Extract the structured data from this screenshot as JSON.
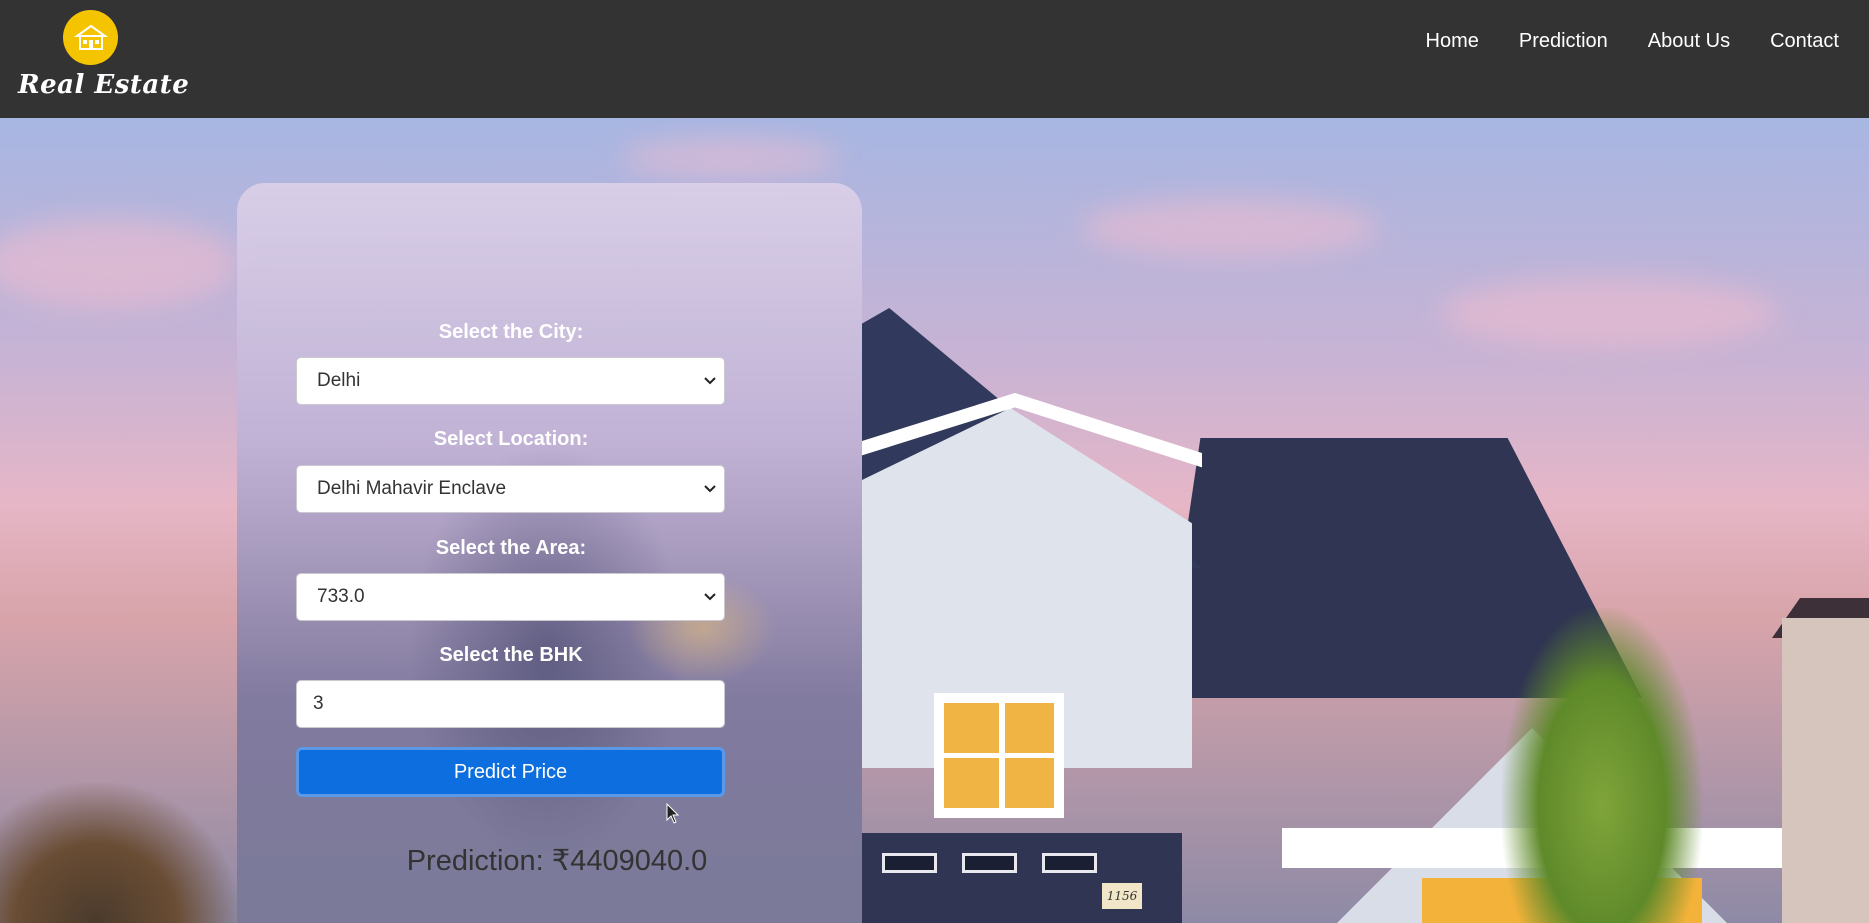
{
  "header": {
    "brand": "Real Estate",
    "nav": [
      "Home",
      "Prediction",
      "About Us",
      "Contact"
    ]
  },
  "form": {
    "city_label": "Select the City:",
    "city_value": "Delhi",
    "location_label": "Select Location:",
    "location_value": "Delhi Mahavir Enclave",
    "area_label": "Select the Area:",
    "area_value": "733.0",
    "bhk_label": "Select the BHK",
    "bhk_value": "3",
    "submit_label": "Predict Price",
    "result": "Prediction: ₹4409040.0"
  },
  "house_number": "1156",
  "colors": {
    "topbar": "#333333",
    "logo": "#f5c400",
    "button": "#0d6ee0"
  },
  "icons": [
    "house-logo-icon",
    "chevron-down-icon",
    "mouse-cursor-icon"
  ]
}
